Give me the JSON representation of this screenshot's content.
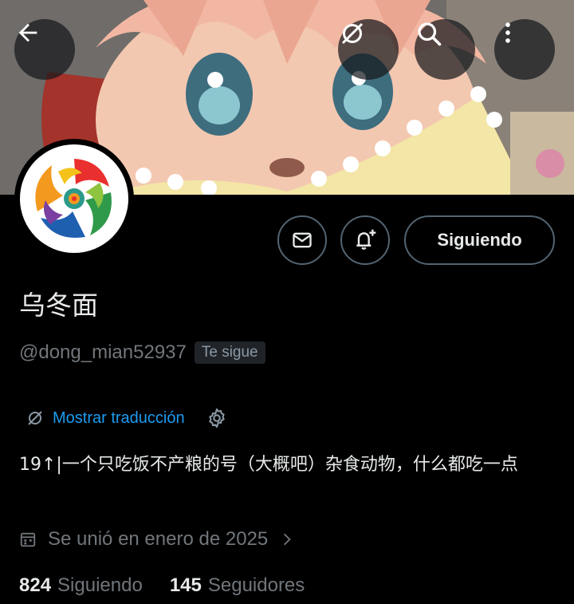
{
  "profile": {
    "display_name": "乌冬面",
    "handle": "@dong_mian52937",
    "follows_you": "Te sigue",
    "translate_label": "Mostrar traducción",
    "bio": "19↑|一个只吃饭不产粮的号（大概吧）杂食动物，什么都吃一点",
    "joined": "Se unió en enero de 2025",
    "following_count": "824",
    "following_label": "Siguiendo",
    "followers_count": "145",
    "followers_label": "Seguidores"
  },
  "actions": {
    "follow_state_label": "Siguiendo"
  },
  "icons": {
    "back": "arrow-left-icon",
    "translate": "translate-slash-icon",
    "search": "search-icon",
    "more": "more-vertical-icon",
    "message": "envelope-icon",
    "notify": "bell-plus-icon",
    "settings": "gear-icon",
    "calendar": "calendar-icon",
    "chevron": "chevron-right-icon"
  },
  "colors": {
    "background": "#000000",
    "accent": "#1d9bf0",
    "muted": "#71767b",
    "border": "#536471"
  }
}
